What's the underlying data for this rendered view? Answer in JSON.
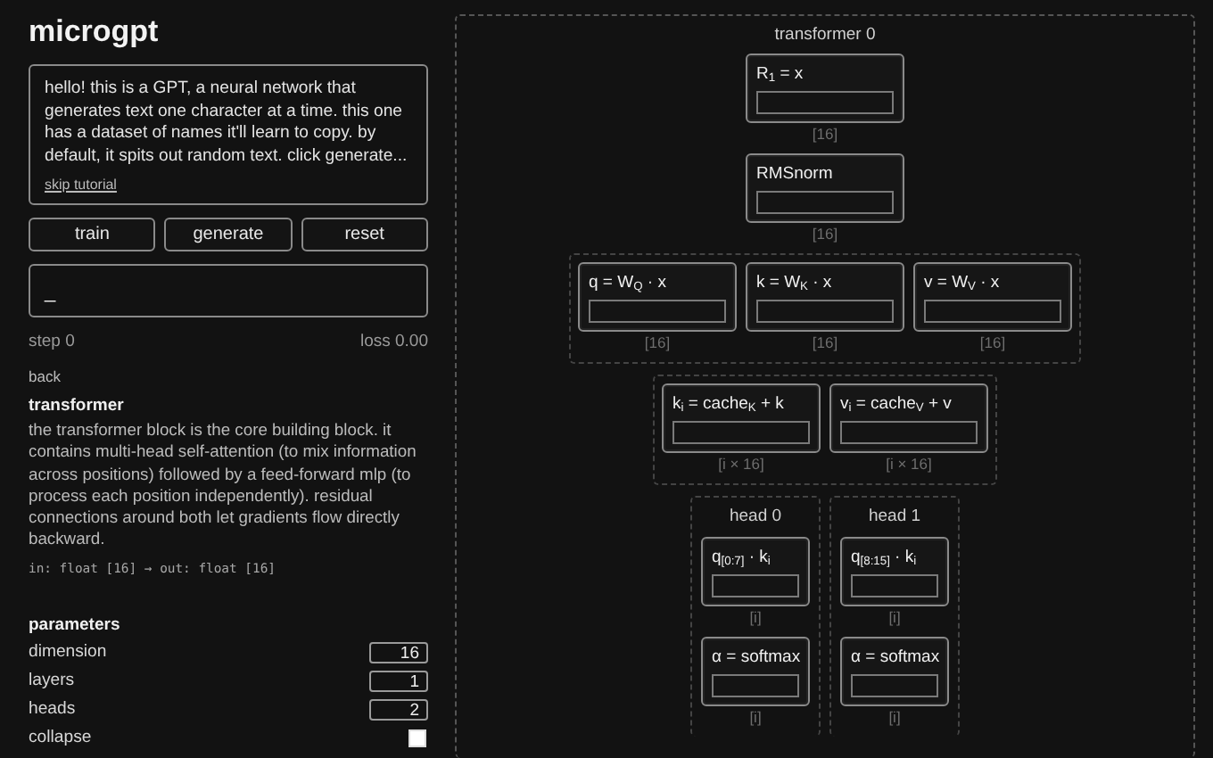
{
  "app": {
    "title": "microgpt"
  },
  "tutorial": {
    "text": "hello! this is a GPT, a neural network that generates text one character at a time. this one has a dataset of names it'll learn to copy. by default, it spits out random text. click generate...",
    "link": "skip tutorial"
  },
  "buttons": [
    "train",
    "generate",
    "reset"
  ],
  "output": {
    "value": "_"
  },
  "status": {
    "step": "step 0",
    "loss": "loss 0.00"
  },
  "back": "back",
  "info": {
    "title": "transformer",
    "description": "the transformer block is the core building block. it contains multi-head self-attention (to mix information across positions) followed by a feed-forward mlp (to process each position independently). residual connections around both let gradients flow directly backward.",
    "signature": "in: float [16] → out: float [16]"
  },
  "parameters": {
    "title": "parameters",
    "items": [
      {
        "kind": "number",
        "label": "dimension",
        "value": "16"
      },
      {
        "kind": "number",
        "label": "layers",
        "value": "1"
      },
      {
        "kind": "number",
        "label": "heads",
        "value": "2"
      },
      {
        "kind": "checkbox",
        "label": "collapse",
        "checked": false
      }
    ]
  },
  "diagram": {
    "title": "transformer 0",
    "sections": [
      {
        "kind": "single",
        "nodes": [
          {
            "label": "R$_{1}$ = x",
            "size": "[16]"
          }
        ]
      },
      {
        "kind": "single",
        "nodes": [
          {
            "label": "RMSnorm",
            "size": "[16]"
          }
        ]
      },
      {
        "kind": "group",
        "nodes": [
          {
            "label": "q = W$_{Q}$ · x",
            "size": "[16]"
          },
          {
            "label": "k = W$_{K}$ · x",
            "size": "[16]"
          },
          {
            "label": "v = W$_{V}$ · x",
            "size": "[16]"
          }
        ]
      },
      {
        "kind": "group",
        "nodes": [
          {
            "label": "k$_{i}$ = cache$_{K}$ + k",
            "size": "[i × 16]"
          },
          {
            "label": "v$_{i}$ = cache$_{V}$ + v",
            "size": "[i × 16]"
          }
        ]
      },
      {
        "kind": "heads",
        "heads": [
          {
            "title": "head 0",
            "nodes": [
              {
                "label": "q$_{[0:7]}$ · k$_{i}$",
                "size": "[i]"
              },
              {
                "label": "α = softmax",
                "size": "[i]"
              }
            ]
          },
          {
            "title": "head 1",
            "nodes": [
              {
                "label": "q$_{[8:15]}$ · k$_{i}$",
                "size": "[i]"
              },
              {
                "label": "α = softmax",
                "size": "[i]"
              }
            ]
          }
        ]
      }
    ]
  }
}
